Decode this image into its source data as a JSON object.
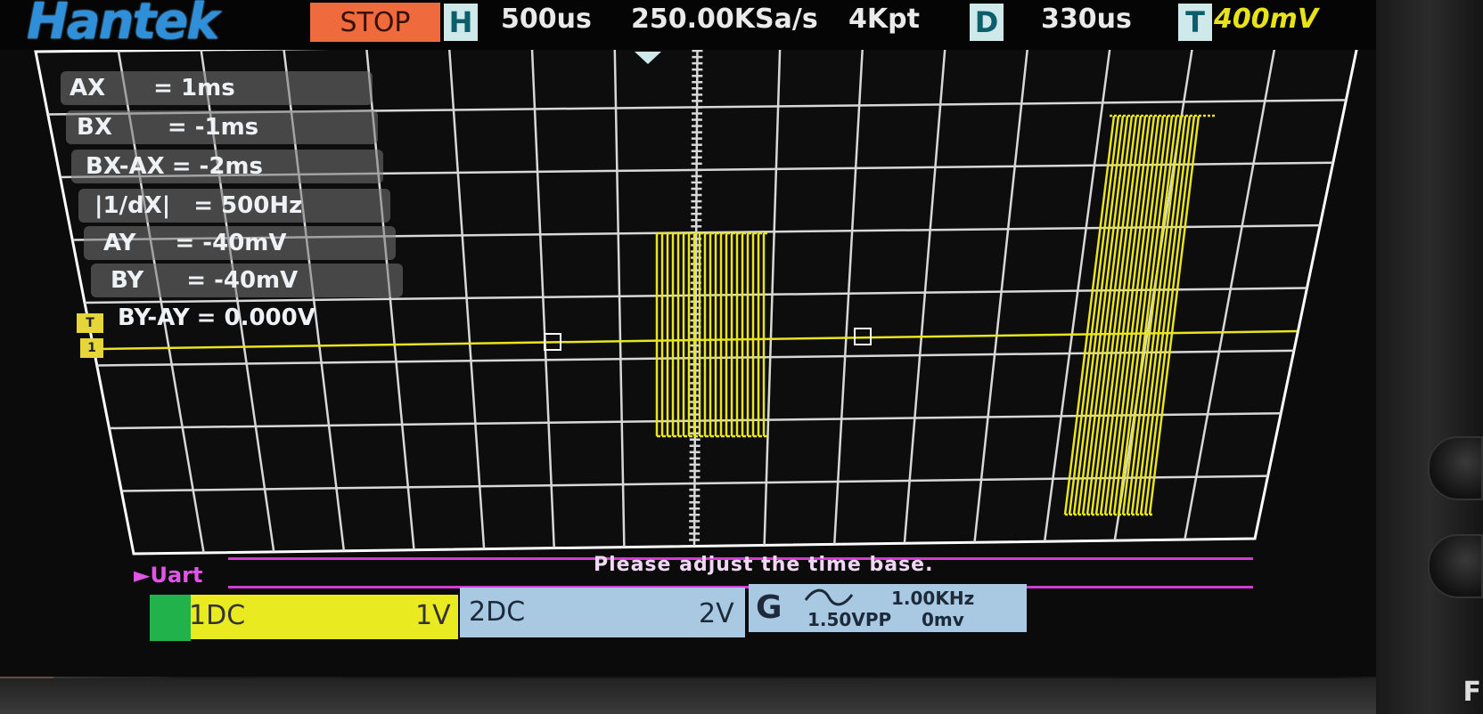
{
  "header": {
    "brand": "Hantek",
    "run_state": "STOP",
    "horizontal_key": "H",
    "timebase": "500us",
    "sample_rate": "250.00KSa/s",
    "memory_depth": "4Kpt",
    "delay_key": "D",
    "delay": "330us",
    "trigger_key": "T",
    "trigger_level": "400mV"
  },
  "cursors": [
    {
      "label": "AX",
      "value": "= 1ms"
    },
    {
      "label": "BX",
      "value": "= -1ms"
    },
    {
      "label": "BX-AX",
      "value": "= -2ms"
    },
    {
      "label": "|1/dX|",
      "value": "= 500Hz"
    },
    {
      "label": "AY",
      "value": "= -40mV"
    },
    {
      "label": "BY",
      "value": "= -40mV"
    },
    {
      "label": "BY-AY",
      "value": "= 0.000V"
    }
  ],
  "markers": {
    "trigger": "T",
    "channel": "1"
  },
  "decode": {
    "protocol": "Uart",
    "message": "Please adjust the time base."
  },
  "channels": {
    "ch1": {
      "name": "1DC",
      "scale": "1V"
    },
    "ch2": {
      "name": "2DC",
      "scale": "2V"
    }
  },
  "generator": {
    "key": "G",
    "waveform_icon": "sine-wave-icon",
    "frequency": "1.00KHz",
    "amplitude": "1.50VPP",
    "offset": "0mv"
  },
  "side_key": "F",
  "colors": {
    "trace": "#e8e41e",
    "grid": "#d8d8d8",
    "decode": "#d23bd6",
    "brand": "#2f8fd8",
    "stop": "#ef6a3c"
  }
}
